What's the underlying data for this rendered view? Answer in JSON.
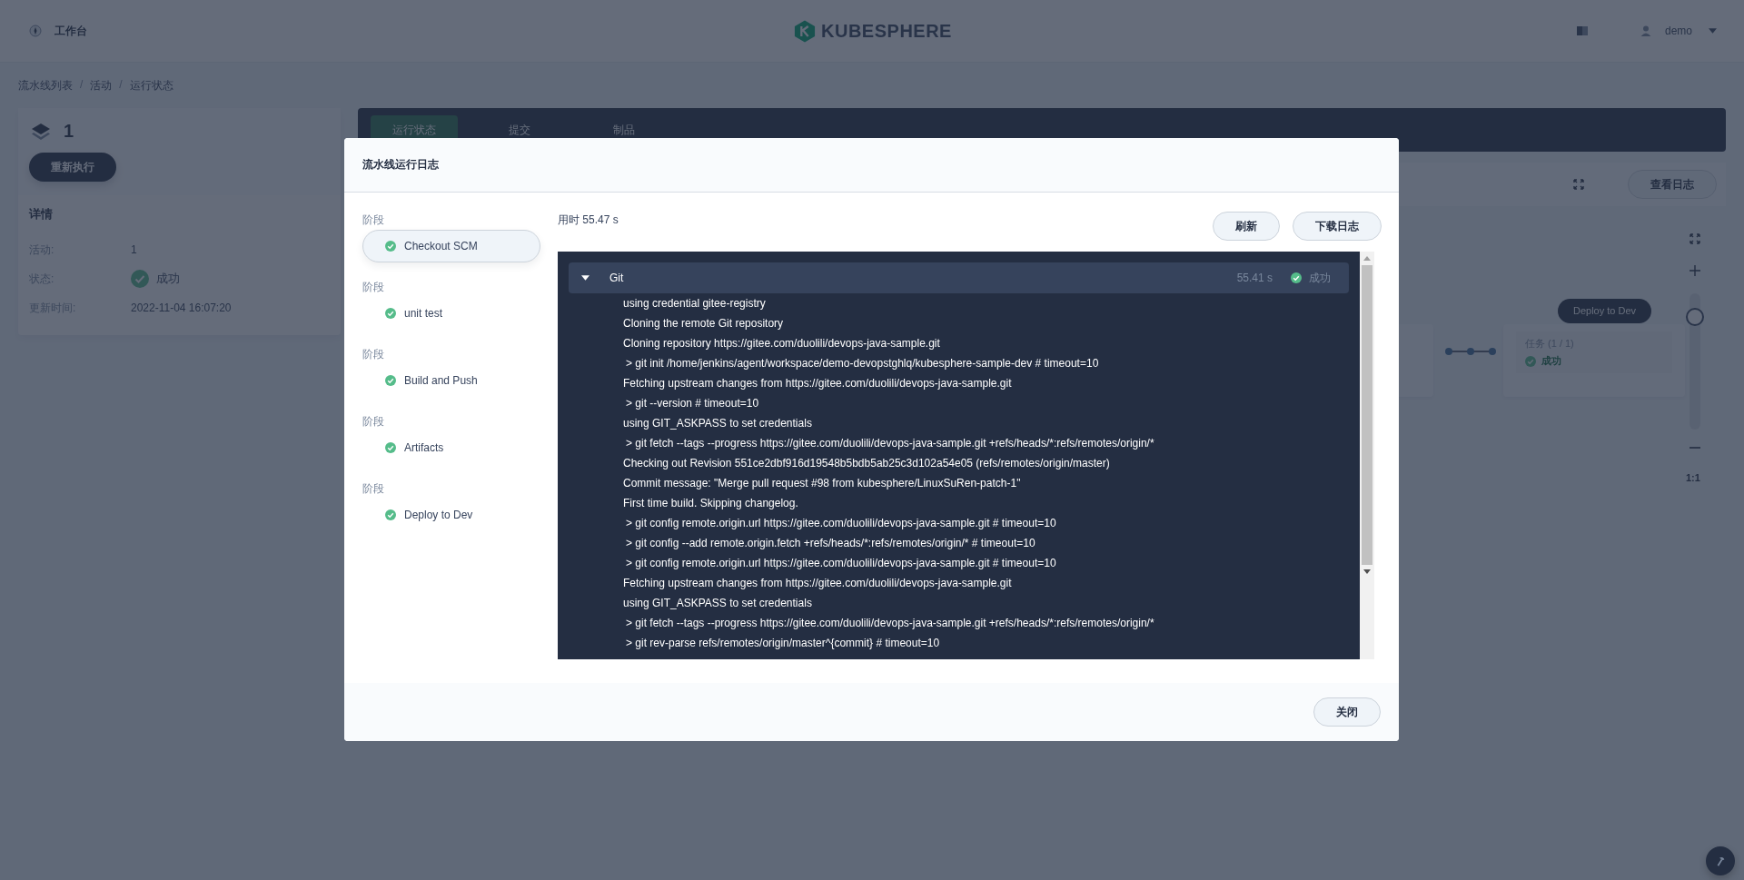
{
  "top_bar": {
    "workbench": "工作台",
    "logo": "KUBESPHERE",
    "user": "demo"
  },
  "breadcrumb": {
    "separator": "/",
    "items": [
      "流水线列表",
      "活动",
      "运行状态"
    ]
  },
  "run_card": {
    "number": "1",
    "rerun_button": "重新执行",
    "details_title": "详情",
    "fields": [
      {
        "label": "活动:",
        "value": "1",
        "kind": "text"
      },
      {
        "label": "状态:",
        "value": "成功",
        "kind": "status"
      },
      {
        "label": "更新时间:",
        "value": "2022-11-04 16:07:20",
        "kind": "text"
      }
    ]
  },
  "tabs": [
    {
      "label": "运行状态",
      "selected": true
    },
    {
      "label": "提交",
      "selected": false
    },
    {
      "label": "制品",
      "selected": false
    }
  ],
  "view_log_button": "查看日志",
  "graph": {
    "stage_name": "Deploy to Dev",
    "task_count": "任务 (1 / 1)",
    "task_status": "成功",
    "zoom": {
      "level": 0.83,
      "reset": "1:1"
    }
  },
  "modal": {
    "title": "流水线运行日志",
    "stages": [
      {
        "label": "阶段",
        "name": "Checkout SCM",
        "selected": true
      },
      {
        "label": "阶段",
        "name": "unit test",
        "selected": false
      },
      {
        "label": "阶段",
        "name": "Build and Push",
        "selected": false
      },
      {
        "label": "阶段",
        "name": "Artifacts",
        "selected": false
      },
      {
        "label": "阶段",
        "name": "Deploy to Dev",
        "selected": false
      }
    ],
    "elapsed": "用时 55.47 s",
    "refresh_button": "刷新",
    "download_button": "下载日志",
    "log_step": {
      "name": "Git",
      "expanded": true,
      "duration": "55.41 s",
      "status": "成功"
    },
    "log_lines": [
      {
        "text": "using credential gitee-registry",
        "kind": "message"
      },
      {
        "text": "Cloning the remote Git repository",
        "kind": "message"
      },
      {
        "text": "Cloning repository https://gitee.com/duolili/devops-java-sample.git",
        "kind": "message"
      },
      {
        "text": "> git init /home/jenkins/agent/workspace/demo-devopstghlq/kubesphere-sample-dev # timeout=10",
        "kind": "command"
      },
      {
        "text": "Fetching upstream changes from https://gitee.com/duolili/devops-java-sample.git",
        "kind": "message"
      },
      {
        "text": "> git --version # timeout=10",
        "kind": "command"
      },
      {
        "text": "using GIT_ASKPASS to set credentials",
        "kind": "message"
      },
      {
        "text": "> git fetch --tags --progress https://gitee.com/duolili/devops-java-sample.git +refs/heads/*:refs/remotes/origin/*",
        "kind": "command"
      },
      {
        "text": "Checking out Revision 551ce2dbf916d19548b5bdb5ab25c3d102a54e05 (refs/remotes/origin/master)",
        "kind": "message"
      },
      {
        "text": "Commit message: \"Merge pull request #98 from kubesphere/LinuxSuRen-patch-1\"",
        "kind": "message"
      },
      {
        "text": "First time build. Skipping changelog.",
        "kind": "message"
      },
      {
        "text": "> git config remote.origin.url https://gitee.com/duolili/devops-java-sample.git # timeout=10",
        "kind": "command"
      },
      {
        "text": "> git config --add remote.origin.fetch +refs/heads/*:refs/remotes/origin/* # timeout=10",
        "kind": "command"
      },
      {
        "text": "> git config remote.origin.url https://gitee.com/duolili/devops-java-sample.git # timeout=10",
        "kind": "command"
      },
      {
        "text": "Fetching upstream changes from https://gitee.com/duolili/devops-java-sample.git",
        "kind": "message"
      },
      {
        "text": "using GIT_ASKPASS to set credentials",
        "kind": "message"
      },
      {
        "text": "> git fetch --tags --progress https://gitee.com/duolili/devops-java-sample.git +refs/heads/*:refs/remotes/origin/*",
        "kind": "command"
      },
      {
        "text": "> git rev-parse refs/remotes/origin/master^{commit} # timeout=10",
        "kind": "command"
      }
    ],
    "close_button": "关闭"
  }
}
